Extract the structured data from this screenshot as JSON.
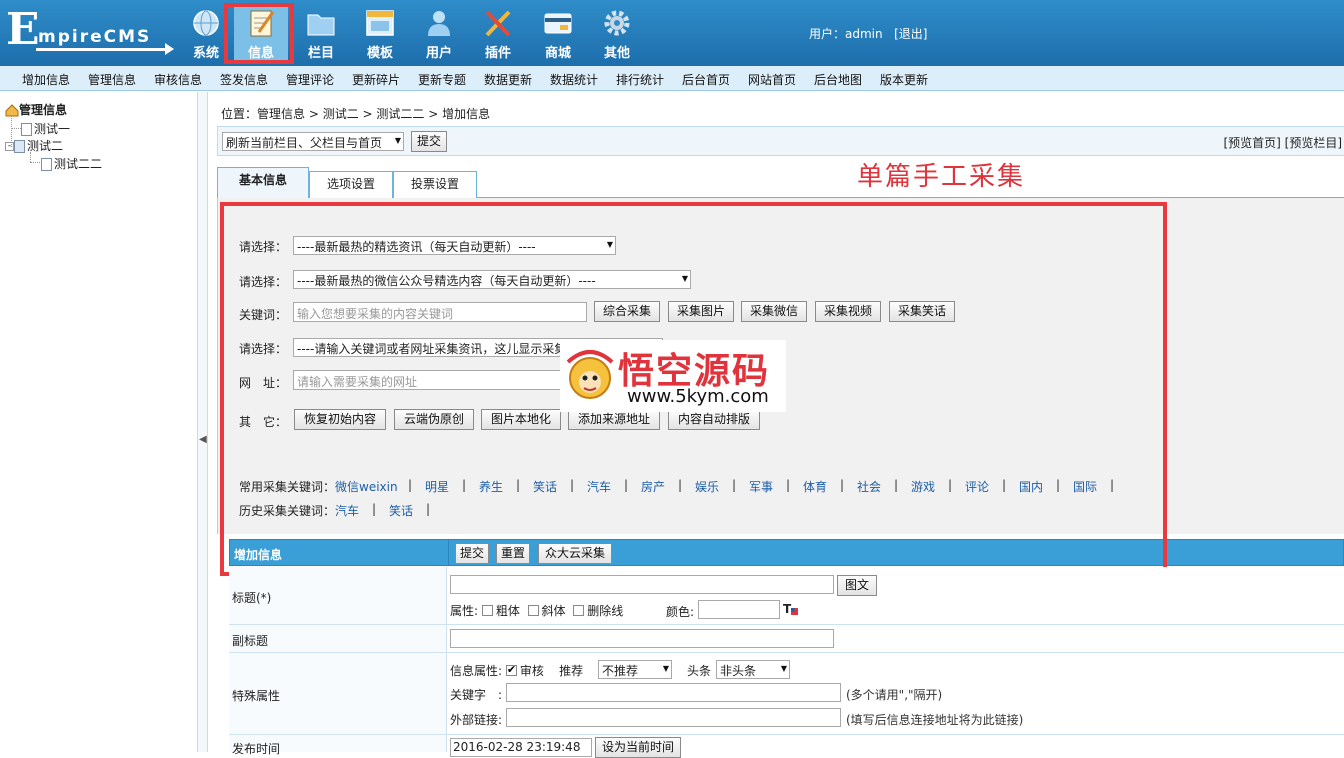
{
  "header": {
    "logo_first": "E",
    "logo_rest": "mpireCMS",
    "nav": [
      {
        "label": "系统",
        "icon": "globe-icon"
      },
      {
        "label": "信息",
        "icon": "notepad-icon",
        "active": true
      },
      {
        "label": "栏目",
        "icon": "folder-icon"
      },
      {
        "label": "模板",
        "icon": "window-icon"
      },
      {
        "label": "用户",
        "icon": "user-icon"
      },
      {
        "label": "插件",
        "icon": "tools-icon"
      },
      {
        "label": "商城",
        "icon": "shop-icon"
      },
      {
        "label": "其他",
        "icon": "gear-icon"
      }
    ],
    "user_prefix": "用户：",
    "username": "admin",
    "logout": "[退出]"
  },
  "submenu": [
    "增加信息",
    "管理信息",
    "审核信息",
    "签发信息",
    "管理评论",
    "更新碎片",
    "更新专题",
    "数据更新",
    "数据统计",
    "排行统计",
    "后台首页",
    "网站首页",
    "后台地图",
    "版本更新"
  ],
  "tree": {
    "root": "管理信息",
    "items": [
      "测试一",
      "测试二",
      "测试二二"
    ]
  },
  "breadcrumb": {
    "prefix": "位置：",
    "path": "管理信息 > 测试二 > 测试二二 > 增加信息"
  },
  "toolbar": {
    "refresh_select": "刷新当前栏目、父栏目与首页",
    "submit": "提交",
    "preview_links": "[预览首页] [预览栏目]"
  },
  "tabs": [
    "基本信息",
    "选项设置",
    "投票设置"
  ],
  "annotation": "单篇手工采集",
  "collect": {
    "label_select": "请选择：",
    "select1": "----最新最热的精选资讯（每天自动更新）----",
    "select2": "----最新最热的微信公众号精选内容（每天自动更新）----",
    "label_keyword": "关键词：",
    "keyword_placeholder": "输入您想要采集的内容关键词",
    "keyword_buttons": [
      "综合采集",
      "采集图片",
      "采集微信",
      "采集视频",
      "采集笑话"
    ],
    "select3": "----请输入关键词或者网址采集资讯，这儿显示采集",
    "label_url": "网　址：",
    "url_placeholder": "请输入需要采集的网址",
    "label_other": "其　它：",
    "other_buttons": [
      "恢复初始内容",
      "云端伪原创",
      "图片本地化",
      "添加来源地址",
      "内容自动排版"
    ],
    "common_label": "常用采集关键词：",
    "common_keywords": [
      "微信weixin",
      "明星",
      "养生",
      "笑话",
      "汽车",
      "房产",
      "娱乐",
      "军事",
      "体育",
      "社会",
      "游戏",
      "评论",
      "国内",
      "国际"
    ],
    "history_label": "历史采集关键词：",
    "history_keywords": [
      "汽车",
      "笑话"
    ]
  },
  "watermark": {
    "cn": "悟空源码",
    "en": "www.5kym.com"
  },
  "form": {
    "head_title": "增加信息",
    "head_buttons": [
      "提交",
      "重置",
      "众大云采集"
    ],
    "title_label": "标题(*)",
    "title_btn": "图文",
    "attr_label": "属性:",
    "attr_options": [
      "粗体",
      "斜体",
      "删除线"
    ],
    "color_label": "颜色:",
    "subtitle_label": "副标题",
    "special_label": "特殊属性",
    "info_attr_label": "信息属性:",
    "audit_label": "审核",
    "recommend_label": "推荐",
    "recommend_value": "不推荐",
    "headline_label": "头条",
    "headline_value": "非头条",
    "keywords_label": "关键字　:",
    "keywords_hint": "(多个请用\",\"隔开)",
    "link_label": "外部链接:",
    "link_hint": "(填写后信息连接地址将为此链接)",
    "pubtime_label": "发布时间",
    "pubtime_value": "2016-02-28 23:19:48",
    "pubtime_btn": "设为当前时间"
  }
}
